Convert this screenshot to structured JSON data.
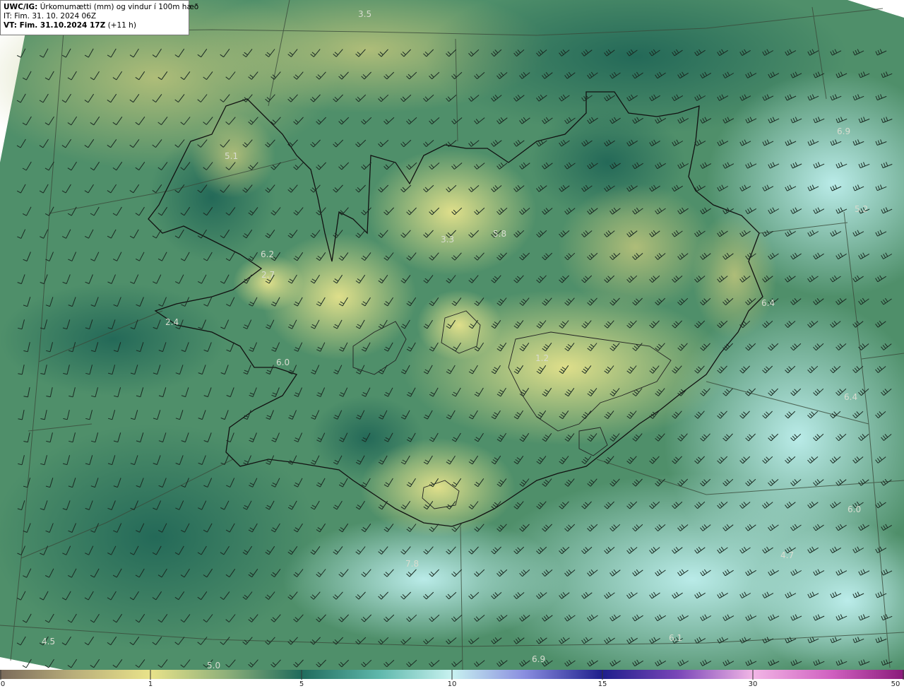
{
  "header": {
    "model": "UWC/IG:",
    "title": "Úrkomumætti (mm) og vindur í 100m hæð",
    "init_time": "IT: Fim. 31. 10. 2024 06Z",
    "valid_label": "VT: Fim. 31.10.2024 17Z",
    "lead": "(+11 h)"
  },
  "map_labels": [
    {
      "id": "l1",
      "text": "3.5"
    },
    {
      "id": "l2",
      "text": "5.1"
    },
    {
      "id": "l3",
      "text": "6.2"
    },
    {
      "id": "l4",
      "text": "2.7"
    },
    {
      "id": "l5",
      "text": "2.4"
    },
    {
      "id": "l6",
      "text": "6.0"
    },
    {
      "id": "l7",
      "text": "3.3"
    },
    {
      "id": "l8",
      "text": "5.8"
    },
    {
      "id": "l9",
      "text": "5.2"
    },
    {
      "id": "l10",
      "text": "6.4"
    },
    {
      "id": "l11",
      "text": "1.2"
    },
    {
      "id": "l12",
      "text": "6.4"
    },
    {
      "id": "l13",
      "text": "7.8"
    },
    {
      "id": "l14",
      "text": "4.5"
    },
    {
      "id": "l15",
      "text": "5.0"
    },
    {
      "id": "l16",
      "text": "6.1"
    },
    {
      "id": "l17",
      "text": "6.9"
    },
    {
      "id": "l18",
      "text": "6.9"
    },
    {
      "id": "l19",
      "text": "4.7"
    },
    {
      "id": "l20",
      "text": "6.0"
    }
  ],
  "colorbar": {
    "ticks": [
      "0",
      "1",
      "5",
      "10",
      "15",
      "30",
      "50"
    ],
    "colors": [
      "#8c7a66",
      "#e9e38a",
      "#1f6b5c",
      "#bff0f0",
      "#2a2aa0",
      "#f0a6e0",
      "#a0208a"
    ]
  }
}
